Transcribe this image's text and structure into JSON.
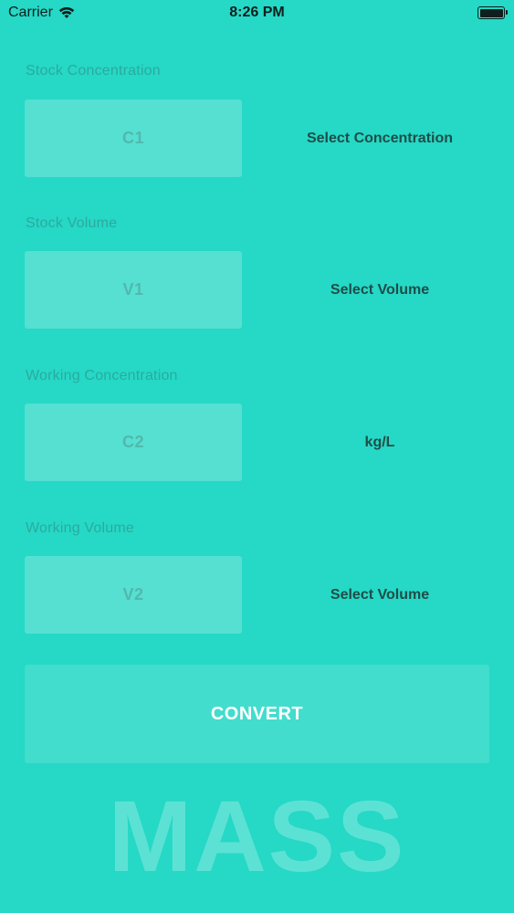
{
  "status_bar": {
    "carrier": "Carrier",
    "time": "8:26 PM",
    "icons": [
      "wifi-icon",
      "battery-icon"
    ]
  },
  "fields": [
    {
      "label": "Stock Concentration",
      "placeholder": "C1",
      "unit": "Select Concentration"
    },
    {
      "label": "Stock Volume",
      "placeholder": "V1",
      "unit": "Select Volume"
    },
    {
      "label": "Working Concentration",
      "placeholder": "C2",
      "unit": "kg/L"
    },
    {
      "label": "Working Volume",
      "placeholder": "V2",
      "unit": "Select Volume"
    }
  ],
  "convert_button": {
    "label": "CONVERT"
  },
  "brand": {
    "text": "MASS"
  },
  "colors": {
    "background": "#26d8c6",
    "label_text": "#2a9d90",
    "unit_text": "#1f4d48",
    "button_text": "#ffffff"
  }
}
